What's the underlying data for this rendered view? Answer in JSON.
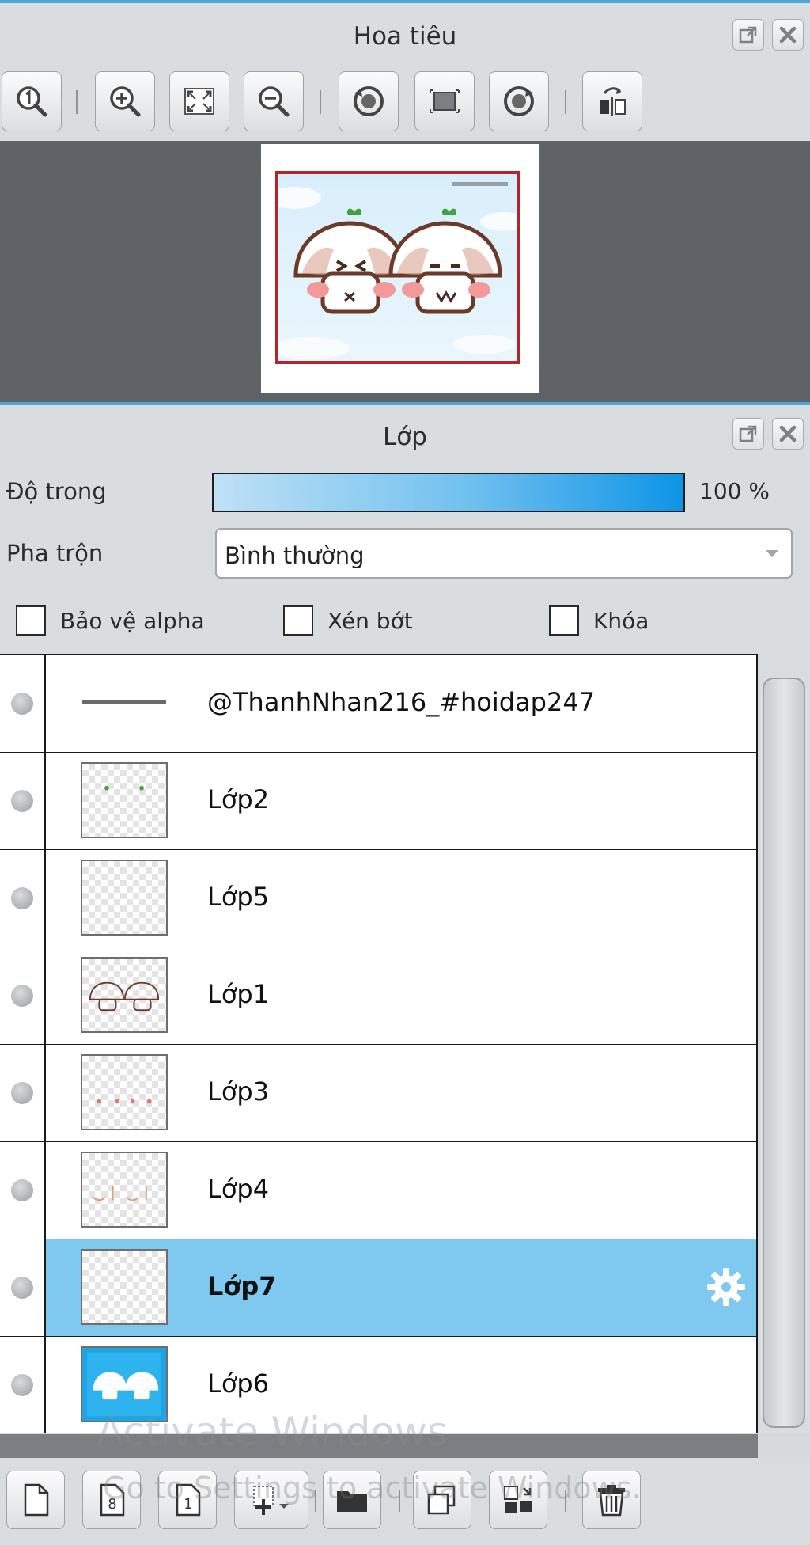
{
  "navigator": {
    "title": "Hoa tiêu",
    "toolbar": [
      {
        "name": "zoom-actual-size-button",
        "icon": "zoom-1-icon"
      },
      {
        "name": "zoom-in-button",
        "icon": "zoom-in-icon"
      },
      {
        "name": "fit-to-window-button",
        "icon": "fit-window-icon"
      },
      {
        "name": "zoom-out-button",
        "icon": "zoom-out-icon"
      },
      {
        "name": "rotate-left-button",
        "icon": "rotate-left-icon"
      },
      {
        "name": "reset-view-button",
        "icon": "reset-view-icon"
      },
      {
        "name": "rotate-right-button",
        "icon": "rotate-right-icon"
      },
      {
        "name": "flip-horizontal-button",
        "icon": "flip-horizontal-icon"
      }
    ]
  },
  "layers_panel": {
    "title": "Lớp",
    "opacity_label": "Độ trong",
    "opacity_value": "100 %",
    "opacity_fraction": 1.0,
    "blend_label": "Pha trộn",
    "blend_value": "Bình thường",
    "checkboxes": {
      "protect_alpha": "Bảo vệ alpha",
      "clipping": "Xén bớt",
      "lock": "Khóa"
    },
    "layers": [
      {
        "name": "@ThanhNhan216_#hoidap247",
        "selected": false
      },
      {
        "name": "Lớp2",
        "selected": false
      },
      {
        "name": "Lớp5",
        "selected": false
      },
      {
        "name": "Lớp1",
        "selected": false
      },
      {
        "name": "Lớp3",
        "selected": false
      },
      {
        "name": "Lớp4",
        "selected": false
      },
      {
        "name": "Lớp7",
        "selected": true
      },
      {
        "name": "Lớp6",
        "selected": false
      }
    ]
  },
  "bottom_toolbar": [
    {
      "name": "new-layer-button",
      "icon": "new-page-icon"
    },
    {
      "name": "new-8bit-layer-button",
      "icon": "page-8-icon"
    },
    {
      "name": "new-1bit-layer-button",
      "icon": "page-1-icon"
    },
    {
      "name": "add-layer-menu-button",
      "icon": "add-layer-icon"
    },
    {
      "name": "new-folder-button",
      "icon": "folder-icon"
    },
    {
      "name": "duplicate-layer-button",
      "icon": "duplicate-icon"
    },
    {
      "name": "merge-down-button",
      "icon": "merge-icon"
    },
    {
      "name": "delete-layer-button",
      "icon": "trash-icon"
    }
  ],
  "watermark": {
    "title": "Activate Windows",
    "subtitle": "Go to Settings to activate Windows."
  },
  "colors": {
    "accent": "#4aa6d6",
    "selected_row": "#7fc9f1",
    "panel_bg": "#dadde0",
    "preview_bg": "#5f6367",
    "frame_red": "#b3252b"
  }
}
